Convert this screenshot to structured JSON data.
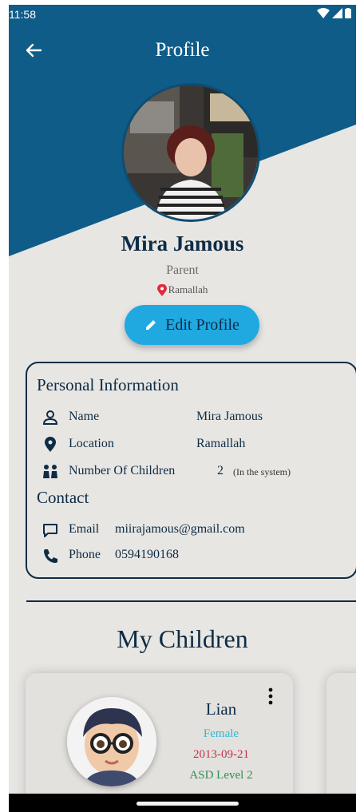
{
  "status_bar": {
    "time": "11:58"
  },
  "app_bar": {
    "title": "Profile"
  },
  "profile": {
    "name": "Mira Jamous",
    "role": "Parent",
    "location": "Ramallah",
    "edit_label": "Edit Profile"
  },
  "personal_info": {
    "title": "Personal Information",
    "name_label": "Name",
    "name_value": "Mira Jamous",
    "location_label": "Location",
    "location_value": "Ramallah",
    "children_label": "Number Of Children",
    "children_value": "2",
    "children_note": "(In the system)"
  },
  "contact": {
    "title": "Contact",
    "email_label": "Email",
    "email_value": "miirajamous@gmail.com",
    "phone_label": "Phone",
    "phone_value": "0594190168"
  },
  "children": {
    "title": "My Children",
    "items": [
      {
        "name": "Lian",
        "gender": "Female",
        "dob": "2013-09-21",
        "level": "ASD Level 2"
      }
    ]
  },
  "colors": {
    "header_blue": "#0f5c89",
    "navy_text": "#0d2c45",
    "accent_button": "#20a9e1",
    "background": "#e8e6e3",
    "location_pin": "#e02b3a"
  },
  "icons": [
    "back-arrow-icon",
    "wifi-icon",
    "signal-icon",
    "battery-icon",
    "location-pin-icon",
    "pencil-icon",
    "person-icon",
    "map-pin-icon",
    "children-icon",
    "chat-icon",
    "phone-icon",
    "more-vert-icon"
  ]
}
